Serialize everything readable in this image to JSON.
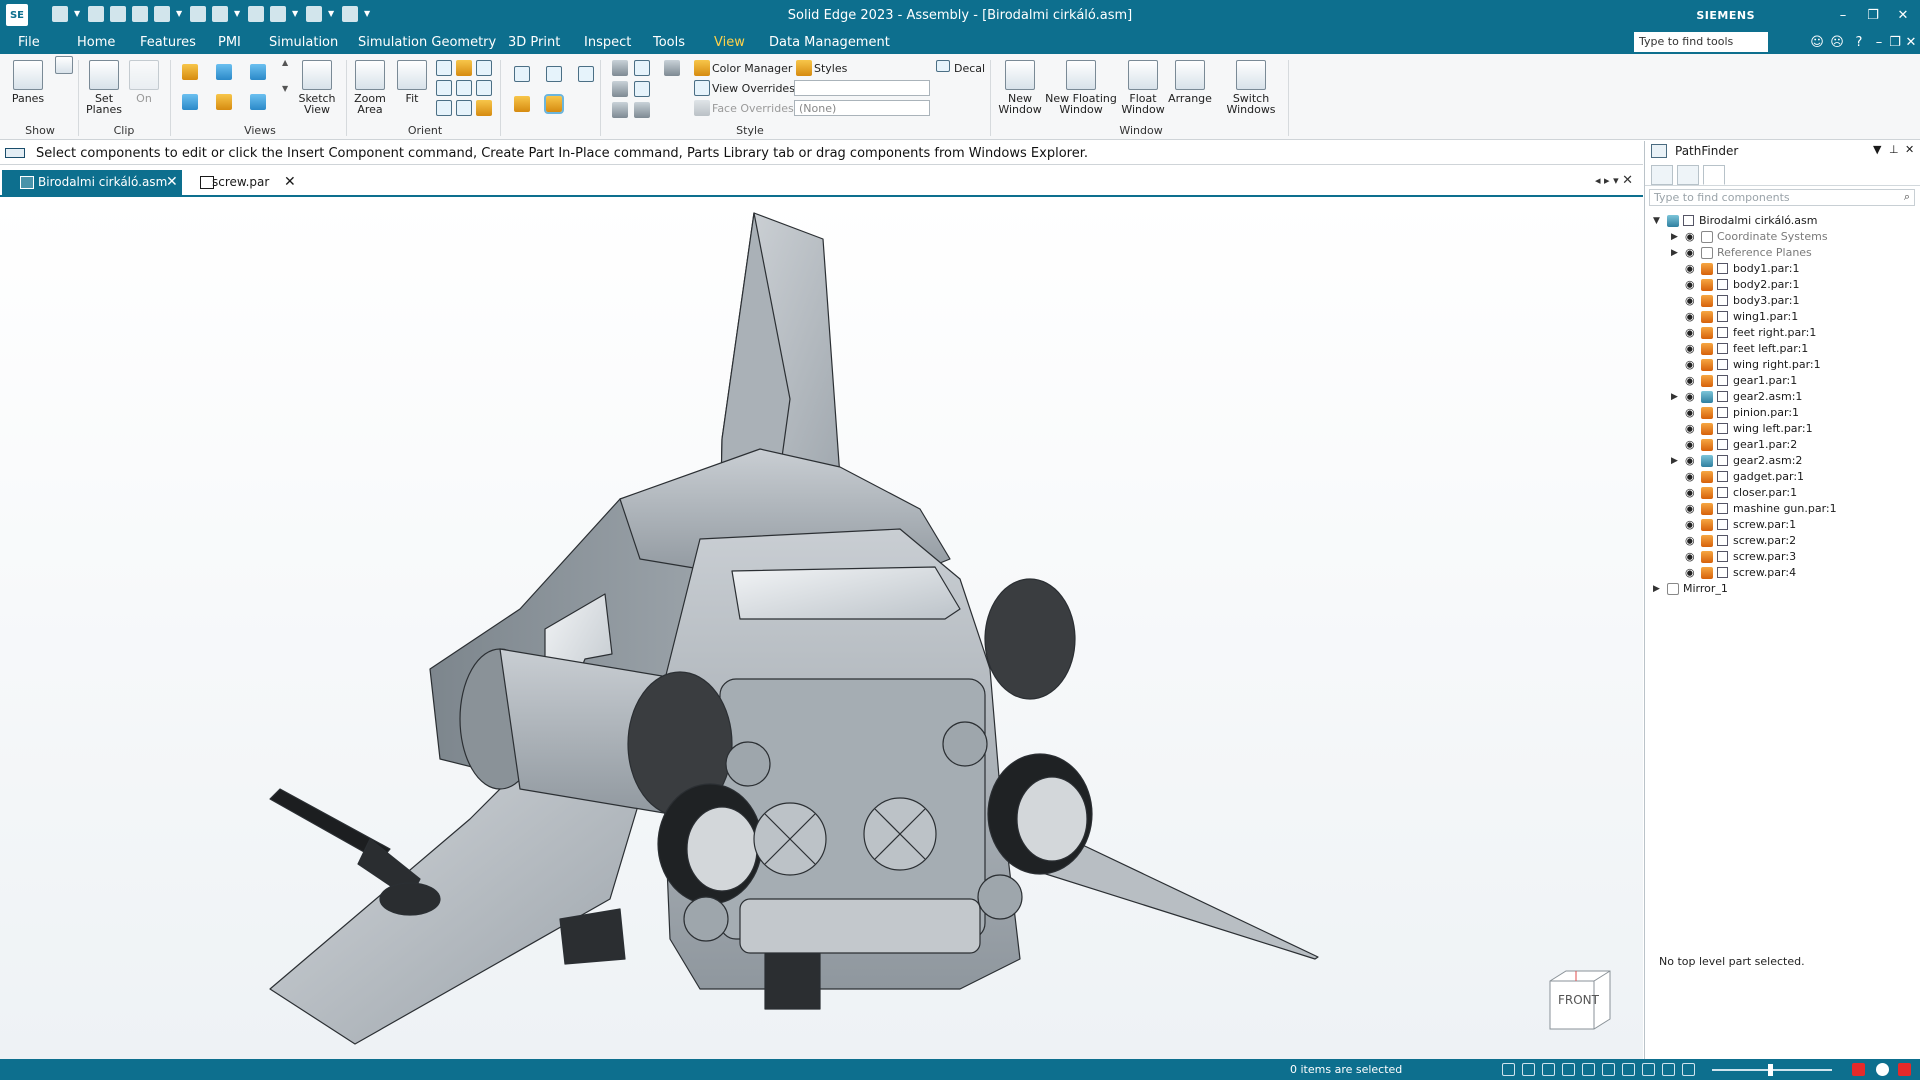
{
  "titlebar": {
    "app_logo": "SE",
    "title": "Solid Edge 2023 - Assembly - [Birodalmi cirkáló.asm]",
    "brand": "SIEMENS",
    "controls": [
      "–",
      "❐",
      "✕"
    ]
  },
  "menu": {
    "tabs": [
      "File",
      "Home",
      "Features",
      "PMI",
      "Simulation",
      "Simulation Geometry",
      "3D Print",
      "Inspect",
      "Tools",
      "View",
      "Data Management"
    ],
    "active_tab": "View",
    "find_placeholder": "Type to find tools",
    "active_color": "#ffd24a"
  },
  "ribbon": {
    "panes": "Panes",
    "set_planes": "Set Planes",
    "on": "On",
    "sketch_view": "Sketch View",
    "zoom_area": "Zoom Area",
    "fit": "Fit",
    "color_manager": "Color Manager",
    "styles": "Styles",
    "view_overrides": "View Overrides",
    "face_overrides": "Face Overrides",
    "face_overrides_value": "(None)",
    "decal": "Decal",
    "new_window": "New Window",
    "new_floating_window": "New Floating Window",
    "float_window": "Float Window",
    "arrange": "Arrange",
    "switch_windows": "Switch Windows",
    "groups": {
      "show": "Show",
      "clip": "Clip",
      "views": "Views",
      "orient": "Orient",
      "style": "Style",
      "window": "Window"
    }
  },
  "prompt": {
    "text": "Select components to edit or click the Insert Component command, Create Part In-Place command, Parts Library tab or drag components from Windows Explorer."
  },
  "doc_tabs": [
    {
      "label": "Birodalmi cirkáló.asm",
      "active": true
    },
    {
      "label": "screw.par",
      "active": false
    }
  ],
  "viewcube": {
    "face": "FRONT"
  },
  "pathfinder": {
    "title": "PathFinder",
    "search_placeholder": "Type to find components",
    "status": "No top level part selected.",
    "tree": [
      {
        "label": "Birodalmi cirkáló.asm",
        "kind": "asm",
        "level": 0,
        "expand": "open"
      },
      {
        "label": "Coordinate Systems",
        "kind": "sys",
        "level": 1,
        "expand": "closed",
        "grey": true
      },
      {
        "label": "Reference Planes",
        "kind": "sys",
        "level": 1,
        "expand": "closed",
        "grey": true
      },
      {
        "label": "body1.par:1",
        "kind": "part",
        "level": 1
      },
      {
        "label": "body2.par:1",
        "kind": "part",
        "level": 1
      },
      {
        "label": "body3.par:1",
        "kind": "part",
        "level": 1
      },
      {
        "label": "wing1.par:1",
        "kind": "part",
        "level": 1
      },
      {
        "label": "feet right.par:1",
        "kind": "part",
        "level": 1
      },
      {
        "label": "feet left.par:1",
        "kind": "part",
        "level": 1
      },
      {
        "label": "wing right.par:1",
        "kind": "part",
        "level": 1
      },
      {
        "label": "gear1.par:1",
        "kind": "part",
        "level": 1
      },
      {
        "label": "gear2.asm:1",
        "kind": "asm",
        "level": 1,
        "expand": "closed"
      },
      {
        "label": "pinion.par:1",
        "kind": "part",
        "level": 1
      },
      {
        "label": "wing left.par:1",
        "kind": "part",
        "level": 1
      },
      {
        "label": "gear1.par:2",
        "kind": "part",
        "level": 1
      },
      {
        "label": "gear2.asm:2",
        "kind": "asm",
        "level": 1,
        "expand": "closed"
      },
      {
        "label": "gadget.par:1",
        "kind": "part",
        "level": 1
      },
      {
        "label": "closer.par:1",
        "kind": "part",
        "level": 1
      },
      {
        "label": "mashine gun.par:1",
        "kind": "part",
        "level": 1
      },
      {
        "label": "screw.par:1",
        "kind": "part",
        "level": 1
      },
      {
        "label": "screw.par:2",
        "kind": "part",
        "level": 1
      },
      {
        "label": "screw.par:3",
        "kind": "part",
        "level": 1
      },
      {
        "label": "screw.par:4",
        "kind": "part",
        "level": 1
      },
      {
        "label": "Mirror_1",
        "kind": "mirror",
        "level": 0,
        "expand": "closed",
        "noeye": true
      }
    ]
  },
  "statusbar": {
    "selection": "0 items are selected"
  }
}
